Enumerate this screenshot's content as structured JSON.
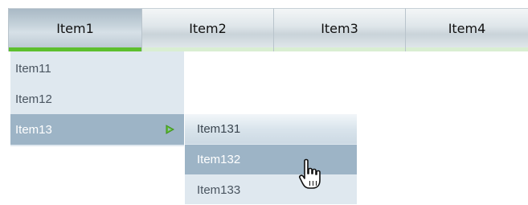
{
  "menubar": {
    "items": [
      {
        "label": "Item1",
        "active": true
      },
      {
        "label": "Item2",
        "active": false
      },
      {
        "label": "Item3",
        "active": false
      },
      {
        "label": "Item4",
        "active": false
      }
    ],
    "active_color": "#5dbf2e"
  },
  "submenu_item1": {
    "items": [
      {
        "label": "Item11"
      },
      {
        "label": "Item12"
      },
      {
        "label": "Item13",
        "selected": true,
        "has_submenu": true,
        "arrow_icon": "triangle-right-icon"
      }
    ]
  },
  "submenu_item13": {
    "items": [
      {
        "label": "Item131"
      },
      {
        "label": "Item132",
        "hovered": true
      },
      {
        "label": "Item133"
      }
    ]
  },
  "cursor": {
    "icon": "hand-pointer-icon"
  },
  "colors": {
    "highlight": "#9db4c6",
    "menu_background": "#dfe8ef",
    "arrow": "#5dbf2e"
  }
}
